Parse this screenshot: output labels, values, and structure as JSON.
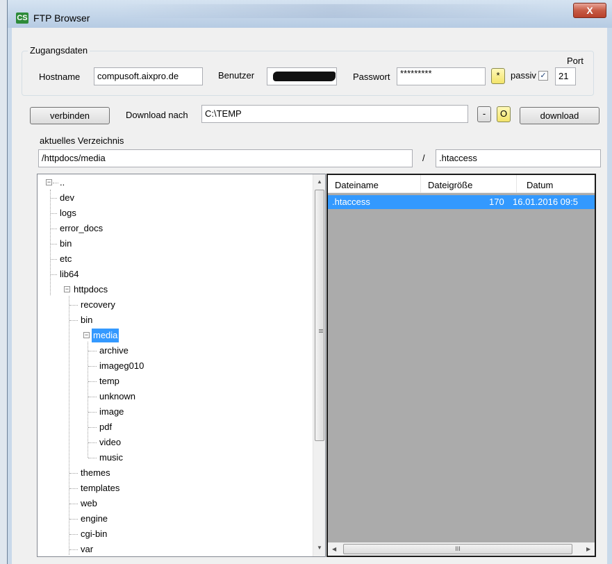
{
  "window": {
    "title": "FTP Browser",
    "app_icon": "CS",
    "close_glyph": "X"
  },
  "credentials": {
    "group_label": "Zugangsdaten",
    "hostname_label": "Hostname",
    "hostname_value": "compusoft.aixpro.de",
    "user_label": "Benutzer",
    "password_label": "Passwort",
    "password_value": "*********",
    "show_password_button": "*",
    "passive_label": "passiv",
    "passive_checked": "✓",
    "port_label": "Port",
    "port_value": "21"
  },
  "toolbar": {
    "connect_button": "verbinden",
    "download_to_label": "Download nach",
    "download_path": "C:\\TEMP",
    "minus_button": "-",
    "open_button": "O",
    "download_button": "download"
  },
  "current_dir": {
    "label": "aktuelles Verzeichnis",
    "path": "/httpdocs/media",
    "separator": "/",
    "file": ".htaccess"
  },
  "tree": {
    "root": "..",
    "items": [
      "dev",
      "logs",
      "error_docs",
      "bin",
      "etc",
      "lib64",
      "httpdocs"
    ],
    "httpdocs_children": [
      "recovery",
      "bin",
      "media"
    ],
    "media_children": [
      "archive",
      "imageg010",
      "temp",
      "unknown",
      "image",
      "pdf",
      "video",
      "music"
    ],
    "httpdocs_rest": [
      "themes",
      "templates",
      "web",
      "engine",
      "cgi-bin",
      "var"
    ],
    "expand_glyph": "−",
    "scroll_up": "▲",
    "scroll_down": "▼"
  },
  "filelist": {
    "columns": [
      "Dateiname",
      "Dateigröße",
      "Datum"
    ],
    "rows": [
      {
        "name": ".htaccess",
        "size": "170",
        "date": "16.01.2016 09:5"
      }
    ],
    "scroll_left": "◀",
    "scroll_right": "▶",
    "thumb_grip": "III"
  }
}
